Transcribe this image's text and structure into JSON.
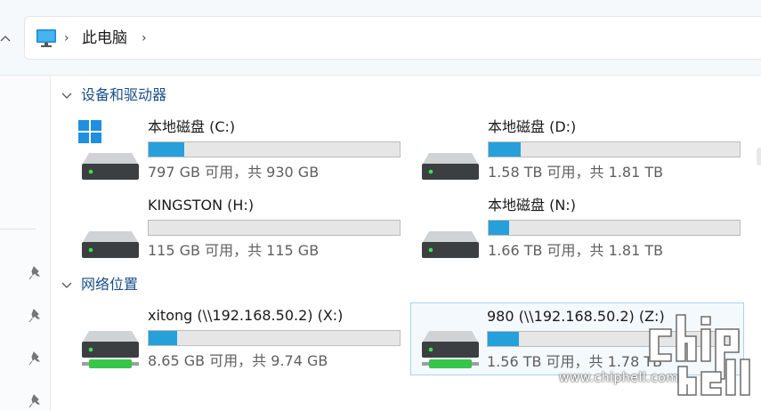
{
  "nav": {
    "up_glyph": "^"
  },
  "address": {
    "separator": "›",
    "crumb": "此电脑",
    "icon": "monitor-icon"
  },
  "groups": {
    "devices": "设备和驱动器",
    "network": "网络位置"
  },
  "drives": [
    {
      "name": "本地磁盘 (C:)",
      "space": "797 GB 可用，共 930 GB",
      "used_fraction": 0.143,
      "icon": "hard-drive-icon"
    },
    {
      "name": "本地磁盘 (D:)",
      "space": "1.58 TB 可用，共 1.81 TB",
      "used_fraction": 0.127,
      "icon": "hard-drive-icon"
    },
    {
      "name": "KINGSTON (H:)",
      "space": "115 GB 可用，共 115 GB",
      "used_fraction": 0.0,
      "icon": "hard-drive-icon"
    },
    {
      "name": "本地磁盘 (N:)",
      "space": "1.66 TB 可用，共 1.81 TB",
      "used_fraction": 0.083,
      "icon": "hard-drive-icon"
    }
  ],
  "network_drives": [
    {
      "name": "xitong (\\\\192.168.50.2) (X:)",
      "space": "8.65 GB 可用，共 9.74 GB",
      "used_fraction": 0.112,
      "icon": "network-drive-icon"
    },
    {
      "name": "980 (\\\\192.168.50.2) (Z:)",
      "space": "1.56 TB 可用，共 1.78 TB",
      "used_fraction": 0.124,
      "icon": "network-drive-icon",
      "selected": true
    }
  ],
  "colors": {
    "accent": "#26a0da",
    "heading": "#1a4e8a",
    "selection_border": "#a8d2f1"
  },
  "watermark": {
    "url": "www.chiphell.com",
    "logo": "chiphell-logo"
  }
}
